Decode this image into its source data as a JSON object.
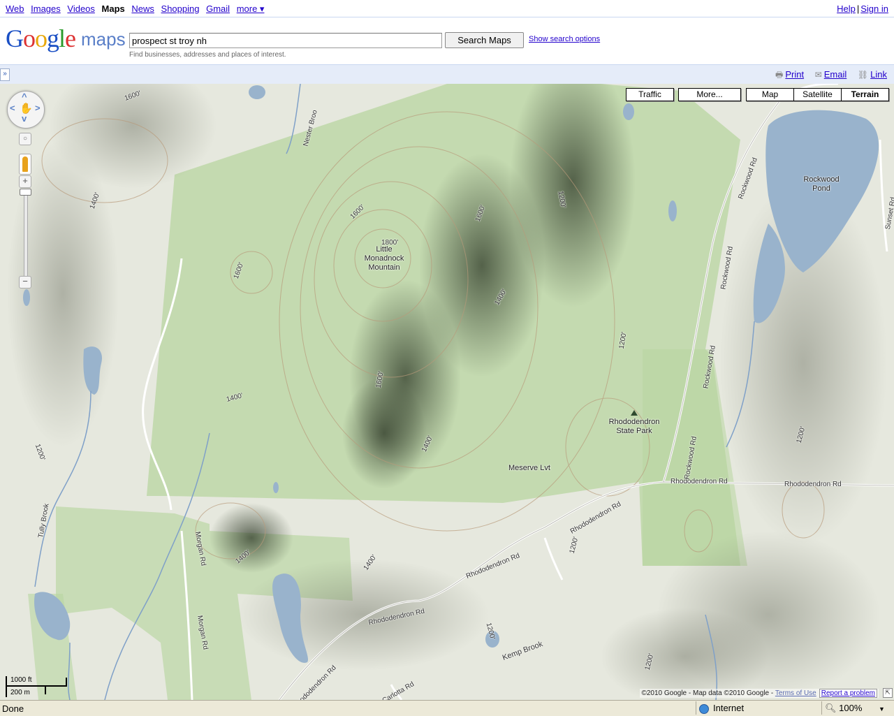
{
  "topnav": {
    "links": [
      "Web",
      "Images",
      "Videos"
    ],
    "active": "Maps",
    "links2": [
      "News",
      "Shopping",
      "Gmail"
    ],
    "more": "more ▾",
    "help": "Help",
    "signin": "Sign in"
  },
  "header": {
    "logo_google": "Google",
    "logo_maps": "maps",
    "search_value": "prospect st troy nh",
    "search_button": "Search Maps",
    "search_options": "Show search options",
    "hint": "Find businesses, addresses and places of interest."
  },
  "panelbar": {
    "toggle": "»",
    "print": "Print",
    "email": "Email",
    "link": "Link"
  },
  "map_controls": {
    "traffic": "Traffic",
    "more": "More...",
    "map": "Map",
    "satellite": "Satellite",
    "terrain": "Terrain",
    "selected": "Terrain"
  },
  "map_labels": {
    "little_monadnock": "Little Monadnock Mountain",
    "rockwood_pond": "Rockwood Pond",
    "rhododendron_park": "Rhododendron State Park",
    "meserve": "Meserve Lvt",
    "nester_brook": "Nester Broo",
    "tully_brook": "Tully Brook",
    "kemp_brook": "Kemp Brook",
    "rhododendron_rd": "Rhododendron Rd",
    "rockwood_rd": "Rockwood Rd",
    "morgan_rd": "Morgan Rd",
    "carlotta_rd": "Carlotta Rd",
    "sunset_rd": "Sunset Rd",
    "contour_1200": "1200'",
    "contour_1400": "1400'",
    "contour_1600": "1600'",
    "contour_1800": "1800'"
  },
  "scale": {
    "imperial": "1000 ft",
    "metric": "200 m"
  },
  "copyright": {
    "text": "©2010 Google - Map data ©2010 Google - ",
    "terms": "Terms of Use",
    "report": "Report a problem"
  },
  "statusbar": {
    "status": "Done",
    "zone": "Internet",
    "zoom": "100%"
  },
  "colors": {
    "park": "#b5d29a",
    "water": "#99b3cc",
    "road": "#ffffff",
    "link": "#2200cc"
  }
}
